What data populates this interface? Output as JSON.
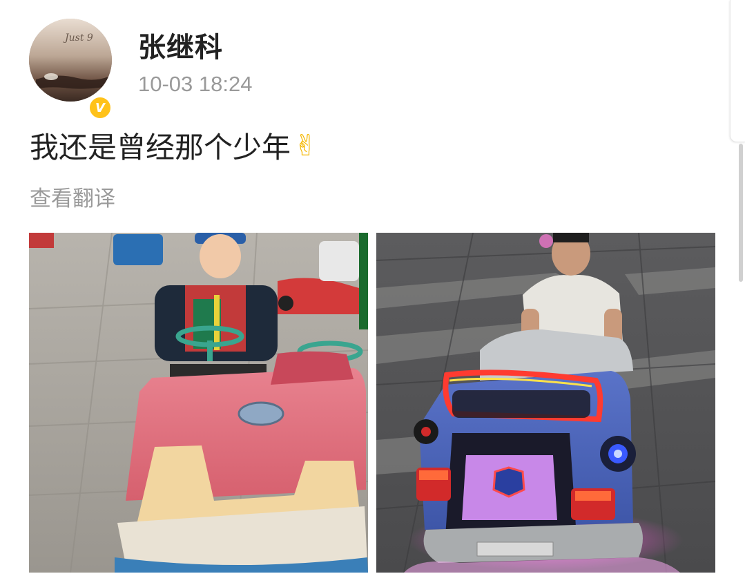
{
  "post": {
    "author": {
      "name": "张继科",
      "verified_badge": "V",
      "avatar_watermark": "Just 9"
    },
    "timestamp": "10-03 18:24",
    "text": "我还是曾经那个少年",
    "emoji": "✌",
    "translate_label": "查看翻译"
  },
  "photos": [
    {
      "name": "childhood-bumper-car-photo"
    },
    {
      "name": "adult-bumper-car-photo"
    }
  ],
  "colors": {
    "verified": "#ffc21a",
    "text_primary": "#222222",
    "text_secondary": "#9a9a9a"
  }
}
